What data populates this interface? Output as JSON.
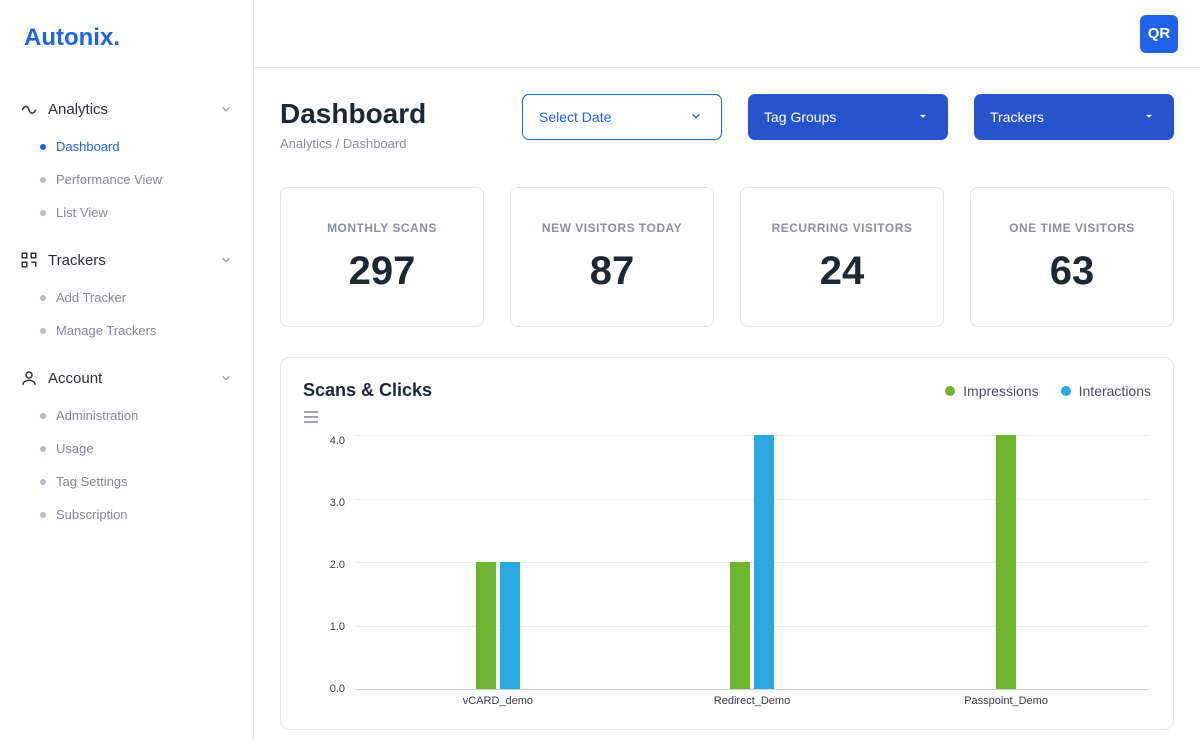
{
  "brand": "Autonix.",
  "avatar": "QR",
  "page": {
    "title": "Dashboard",
    "breadcrumb": "Analytics / Dashboard"
  },
  "filters": {
    "date_label": "Select Date",
    "tag_groups_label": "Tag Groups",
    "trackers_label": "Trackers"
  },
  "sidebar": {
    "analytics": {
      "label": "Analytics",
      "items": [
        {
          "label": "Dashboard",
          "active": true
        },
        {
          "label": "Performance View",
          "active": false
        },
        {
          "label": "List View",
          "active": false
        }
      ]
    },
    "trackers": {
      "label": "Trackers",
      "items": [
        {
          "label": "Add Tracker"
        },
        {
          "label": "Manage Trackers"
        }
      ]
    },
    "account": {
      "label": "Account",
      "items": [
        {
          "label": "Administration"
        },
        {
          "label": "Usage"
        },
        {
          "label": "Tag Settings"
        },
        {
          "label": "Subscription"
        }
      ]
    }
  },
  "stats": [
    {
      "label": "MONTHLY SCANS",
      "value": "297"
    },
    {
      "label": "NEW VISITORS TODAY",
      "value": "87"
    },
    {
      "label": "RECURRING VISITORS",
      "value": "24"
    },
    {
      "label": "ONE TIME VISITORS",
      "value": "63"
    }
  ],
  "chart": {
    "title": "Scans & Clicks",
    "legend": [
      {
        "name": "Impressions",
        "color": "#6EB52F"
      },
      {
        "name": "Interactions",
        "color": "#29A9E0"
      }
    ]
  },
  "chart_data": {
    "type": "bar",
    "title": "Scans & Clicks",
    "categories": [
      "vCARD_demo",
      "Redirect_Demo",
      "Passpoint_Demo"
    ],
    "series": [
      {
        "name": "Impressions",
        "values": [
          2,
          2,
          4
        ]
      },
      {
        "name": "Interactions",
        "values": [
          2,
          4,
          0
        ]
      }
    ],
    "ylim": [
      0,
      4
    ],
    "yticks": [
      0.0,
      1.0,
      2.0,
      3.0,
      4.0
    ],
    "xlabel": "",
    "ylabel": ""
  }
}
